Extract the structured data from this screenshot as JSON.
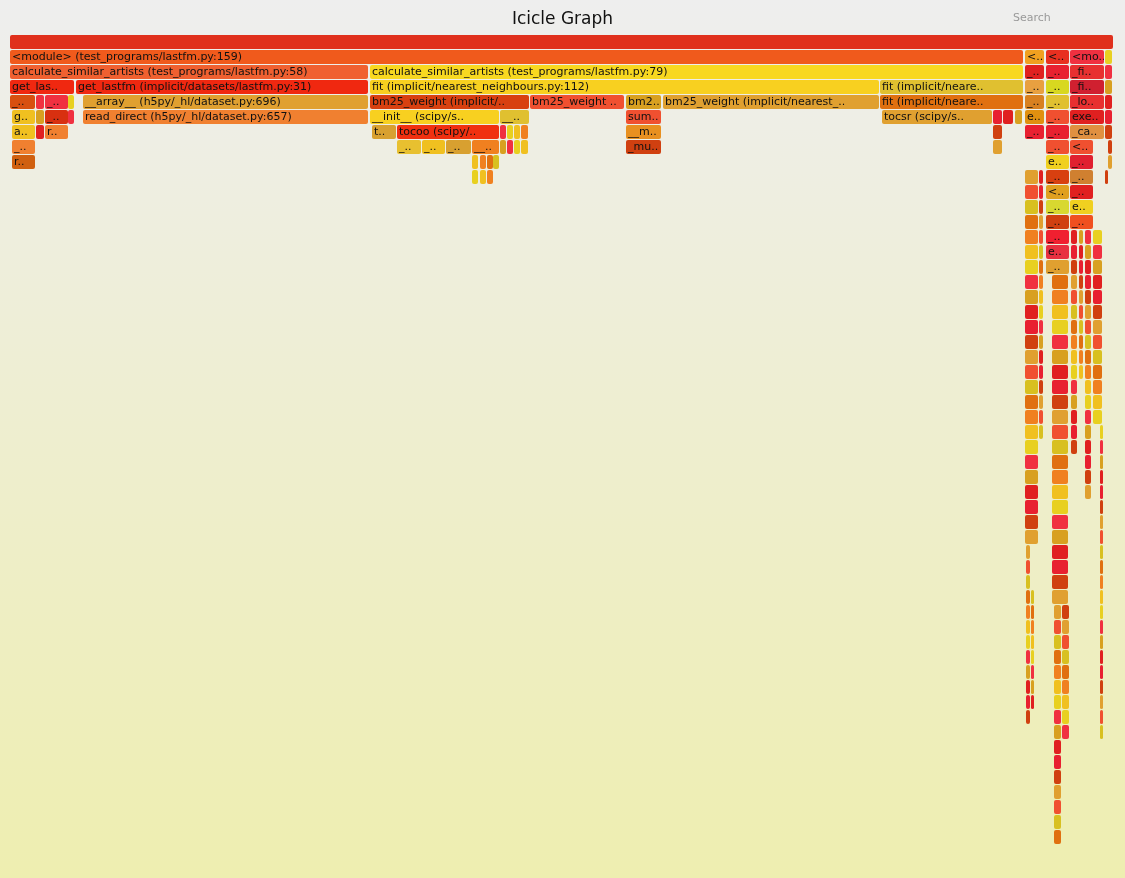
{
  "title": "Icicle Graph",
  "search": {
    "placeholder": "Search"
  },
  "levels": [
    {
      "frames": [
        {
          "label": "<module> (test_programs/lastfm.py:159)",
          "color": "#f05a1c"
        },
        {
          "label": "<..",
          "color": "#f0a020"
        },
        {
          "label": "<..",
          "color": "#e83020"
        },
        {
          "label": "<mo..",
          "color": "#f03040"
        }
      ]
    },
    {
      "frames": [
        {
          "label": "calculate_similar_artists (test_programs/lastfm.py:58)",
          "color": "#f06030"
        },
        {
          "label": "calculate_similar_artists (test_programs/lastfm.py:79)",
          "color": "#f8d820"
        },
        {
          "label": "_..",
          "color": "#e02020"
        },
        {
          "label": "_..",
          "color": "#e82030"
        },
        {
          "label": "_fi..",
          "color": "#e83030"
        }
      ]
    },
    {
      "frames": [
        {
          "label": "get_las..",
          "color": "#f02810"
        },
        {
          "label": "get_lastfm (implicit/datasets/lastfm.py:31)",
          "color": "#f02810"
        },
        {
          "label": "fit (implicit/nearest_neighbours.py:112)",
          "color": "#f8d020"
        },
        {
          "label": "fit (implicit/neare..",
          "color": "#e0c030"
        },
        {
          "label": "_..",
          "color": "#e8a040"
        },
        {
          "label": "_..",
          "color": "#d8d820"
        },
        {
          "label": "_fi..",
          "color": "#d02030"
        }
      ]
    },
    {
      "frames": [
        {
          "label": "_..",
          "color": "#d85010"
        },
        {
          "label": "_..",
          "color": "#f03040"
        },
        {
          "label": "__array__ (h5py/_hl/dataset.py:696)",
          "color": "#e0a030"
        },
        {
          "label": "bm25_weight (implicit/..",
          "color": "#d84010"
        },
        {
          "label": "bm25_weight ..",
          "color": "#f05030"
        },
        {
          "label": "bm2..",
          "color": "#d8a020"
        },
        {
          "label": "bm25_weight (implicit/nearest_..",
          "color": "#e0a030"
        },
        {
          "label": "fit (implicit/neare..",
          "color": "#e07010"
        },
        {
          "label": "_..",
          "color": "#d88020"
        },
        {
          "label": "_..",
          "color": "#e0c030"
        },
        {
          "label": "_lo..",
          "color": "#e83030"
        }
      ]
    },
    {
      "frames": [
        {
          "label": "g..",
          "color": "#f0c020"
        },
        {
          "label": "_..",
          "color": "#d83010"
        },
        {
          "label": "read_direct (h5py/_hl/dataset.py:657)",
          "color": "#f08030"
        },
        {
          "label": "__init__ (scipy/s..",
          "color": "#f8d020"
        },
        {
          "label": "__..",
          "color": "#e0c030"
        },
        {
          "label": "sum..",
          "color": "#f05030"
        },
        {
          "label": "tocsr (scipy/s..",
          "color": "#e0a030"
        },
        {
          "label": "e..",
          "color": "#e09010"
        },
        {
          "label": "_..",
          "color": "#f05030"
        },
        {
          "label": "exe..",
          "color": "#e02020"
        }
      ]
    },
    {
      "frames": [
        {
          "label": "a..",
          "color": "#f0c020"
        },
        {
          "label": "r..",
          "color": "#f08030"
        },
        {
          "label": "t..",
          "color": "#d8a030"
        },
        {
          "label": "tocoo (scipy/..",
          "color": "#f03010"
        },
        {
          "label": "__m..",
          "color": "#e89020"
        },
        {
          "label": "_..",
          "color": "#e82030"
        },
        {
          "label": "_..",
          "color": "#e82030"
        },
        {
          "label": "_ca..",
          "color": "#e09040"
        }
      ]
    },
    {
      "frames": [
        {
          "label": "_..",
          "color": "#f08030"
        },
        {
          "label": "_..",
          "color": "#e8c030"
        },
        {
          "label": "_..",
          "color": "#f0c020"
        },
        {
          "label": "_..",
          "color": "#d8a030"
        },
        {
          "label": "__..",
          "color": "#f08020"
        },
        {
          "label": "_mu..",
          "color": "#d04010"
        },
        {
          "label": "_..",
          "color": "#f05030"
        },
        {
          "label": "<..",
          "color": "#f05030"
        }
      ]
    },
    {
      "frames": [
        {
          "label": "r..",
          "color": "#d06010"
        },
        {
          "label": "e..",
          "color": "#f0d020"
        },
        {
          "label": "_..",
          "color": "#e02030"
        }
      ]
    },
    {
      "frames": [
        {
          "label": "_..",
          "color": "#d84010"
        },
        {
          "label": "_..",
          "color": "#d08030"
        }
      ]
    },
    {
      "frames": [
        {
          "label": "<..",
          "color": "#e0a020"
        },
        {
          "label": "_..",
          "color": "#e02020"
        }
      ]
    },
    {
      "frames": [
        {
          "label": "_..",
          "color": "#d8d830"
        },
        {
          "label": "e..",
          "color": "#f0d020"
        }
      ]
    },
    {
      "frames": [
        {
          "label": "_..",
          "color": "#d04010"
        },
        {
          "label": "_..",
          "color": "#f05020"
        }
      ]
    },
    {
      "frames": [
        {
          "label": "_..",
          "color": "#f02030"
        }
      ]
    },
    {
      "frames": [
        {
          "label": "e..",
          "color": "#e83040"
        }
      ]
    },
    {
      "frames": [
        {
          "label": "_..",
          "color": "#e0a030"
        }
      ]
    }
  ]
}
